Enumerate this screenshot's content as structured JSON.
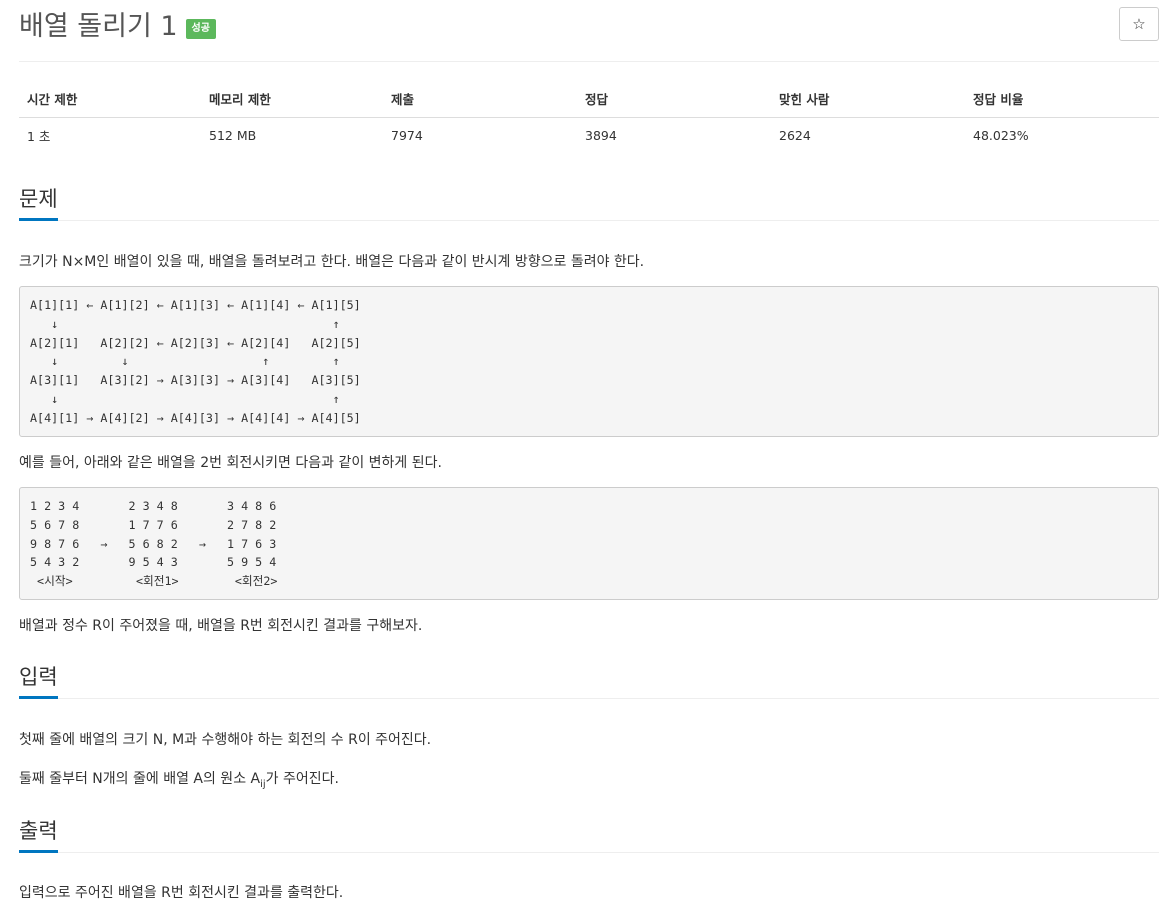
{
  "header": {
    "title": "배열 돌리기 1",
    "badge": "성공",
    "star_glyph": "☆"
  },
  "stats": {
    "headers": [
      "시간 제한",
      "메모리 제한",
      "제출",
      "정답",
      "맞힌 사람",
      "정답 비율"
    ],
    "values": [
      "1 초",
      "512 MB",
      "7974",
      "3894",
      "2624",
      "48.023%"
    ]
  },
  "problem": {
    "heading": "문제",
    "para1": "크기가 N×M인 배열이 있을 때, 배열을 돌려보려고 한다. 배열은 다음과 같이 반시계 방향으로 돌려야 한다.",
    "diagram": "A[1][1] ← A[1][2] ← A[1][3] ← A[1][4] ← A[1][5]\n   ↓                                       ↑\nA[2][1]   A[2][2] ← A[2][3] ← A[2][4]   A[2][5]\n   ↓         ↓                   ↑         ↑\nA[3][1]   A[3][2] → A[3][3] → A[3][4]   A[3][5]\n   ↓                                       ↑\nA[4][1] → A[4][2] → A[4][3] → A[4][4] → A[4][5]",
    "para2": "예를 들어, 아래와 같은 배열을 2번 회전시키면 다음과 같이 변하게 된다.",
    "example": "1 2 3 4       2 3 4 8       3 4 8 6\n5 6 7 8       1 7 7 6       2 7 8 2\n9 8 7 6   →   5 6 8 2   →   1 7 6 3\n5 4 3 2       9 5 4 3       5 9 5 4\n <시작>         <회전1>        <회전2>",
    "para3": "배열과 정수 R이 주어졌을 때, 배열을 R번 회전시킨 결과를 구해보자."
  },
  "input": {
    "heading": "입력",
    "para1": "첫째 줄에 배열의 크기 N, M과 수행해야 하는 회전의 수 R이 주어진다.",
    "para2_before": "둘째 줄부터 N개의 줄에 배열 A의 원소 A",
    "para2_sub": "ij",
    "para2_after": "가 주어진다."
  },
  "output": {
    "heading": "출력",
    "para1": "입력으로 주어진 배열을 R번 회전시킨 결과를 출력한다."
  }
}
